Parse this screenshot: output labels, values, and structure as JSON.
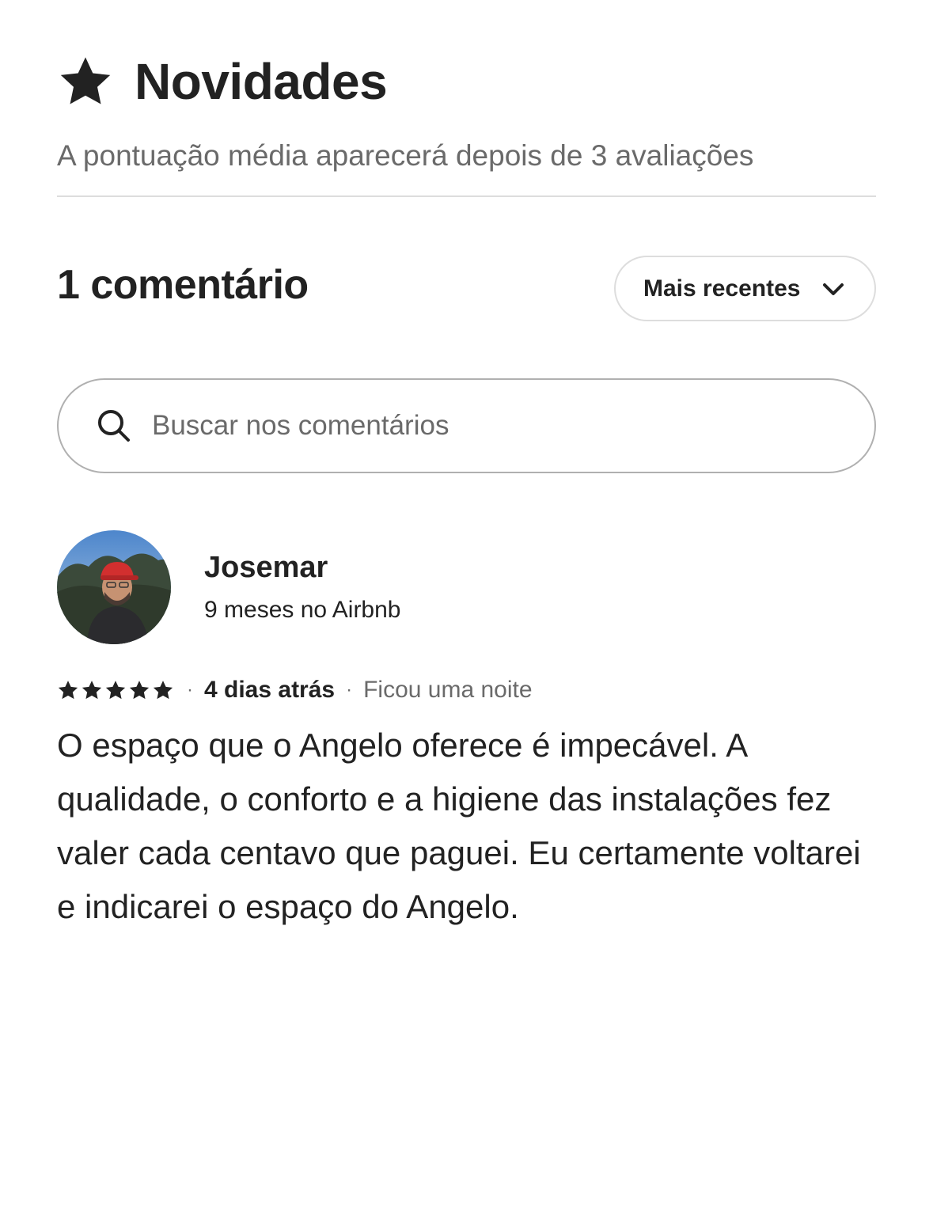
{
  "header": {
    "title": "Novidades",
    "subtitle": "A pontuação média aparecerá depois de 3 avaliações"
  },
  "reviews_section": {
    "count_label": "1 comentário",
    "sort_label": "Mais recentes"
  },
  "search": {
    "placeholder": "Buscar nos comentários",
    "value": ""
  },
  "review": {
    "name": "Josemar",
    "meta": "9 meses no Airbnb",
    "rating": 5,
    "date": "4 dias atrás",
    "stay": "Ficou uma noite",
    "separator": "·",
    "text": "O espaço que o Angelo oferece é impecável. A qualidade, o conforto e a higiene das instalações fez valer cada centavo que paguei. Eu certamente voltarei e indicarei o espaço do Angelo."
  },
  "colors": {
    "text": "#222222",
    "secondary": "#6a6a6a",
    "border": "#dddddd",
    "search_border": "#b0b0b0"
  }
}
